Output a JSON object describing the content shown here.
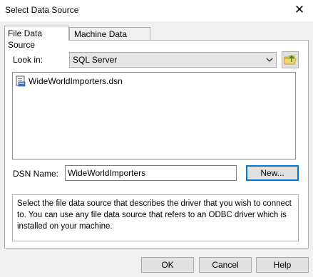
{
  "window": {
    "title": "Select Data Source",
    "close_glyph": "✕"
  },
  "tabs": [
    {
      "label": "File Data Source",
      "active": true
    },
    {
      "label": "Machine Data Source",
      "active": false
    }
  ],
  "look_in": {
    "label": "Look in:",
    "value": "SQL Server"
  },
  "file_list": [
    {
      "name": "WideWorldImporters.dsn",
      "icon": "dsn-file-icon"
    }
  ],
  "dsn": {
    "label": "DSN Name:",
    "value": "WideWorldImporters",
    "new_button": "New..."
  },
  "description": "Select the file data source that describes the driver that you wish to connect to. You can use any file data source that refers to an ODBC driver which is installed on your machine.",
  "buttons": {
    "ok": "OK",
    "cancel": "Cancel",
    "help": "Help"
  },
  "colors": {
    "accent": "#0078d7",
    "window_bg": "#f0f0f0",
    "folder_icon": "#e8c04a",
    "folder_arrow": "#2e8b2e"
  }
}
